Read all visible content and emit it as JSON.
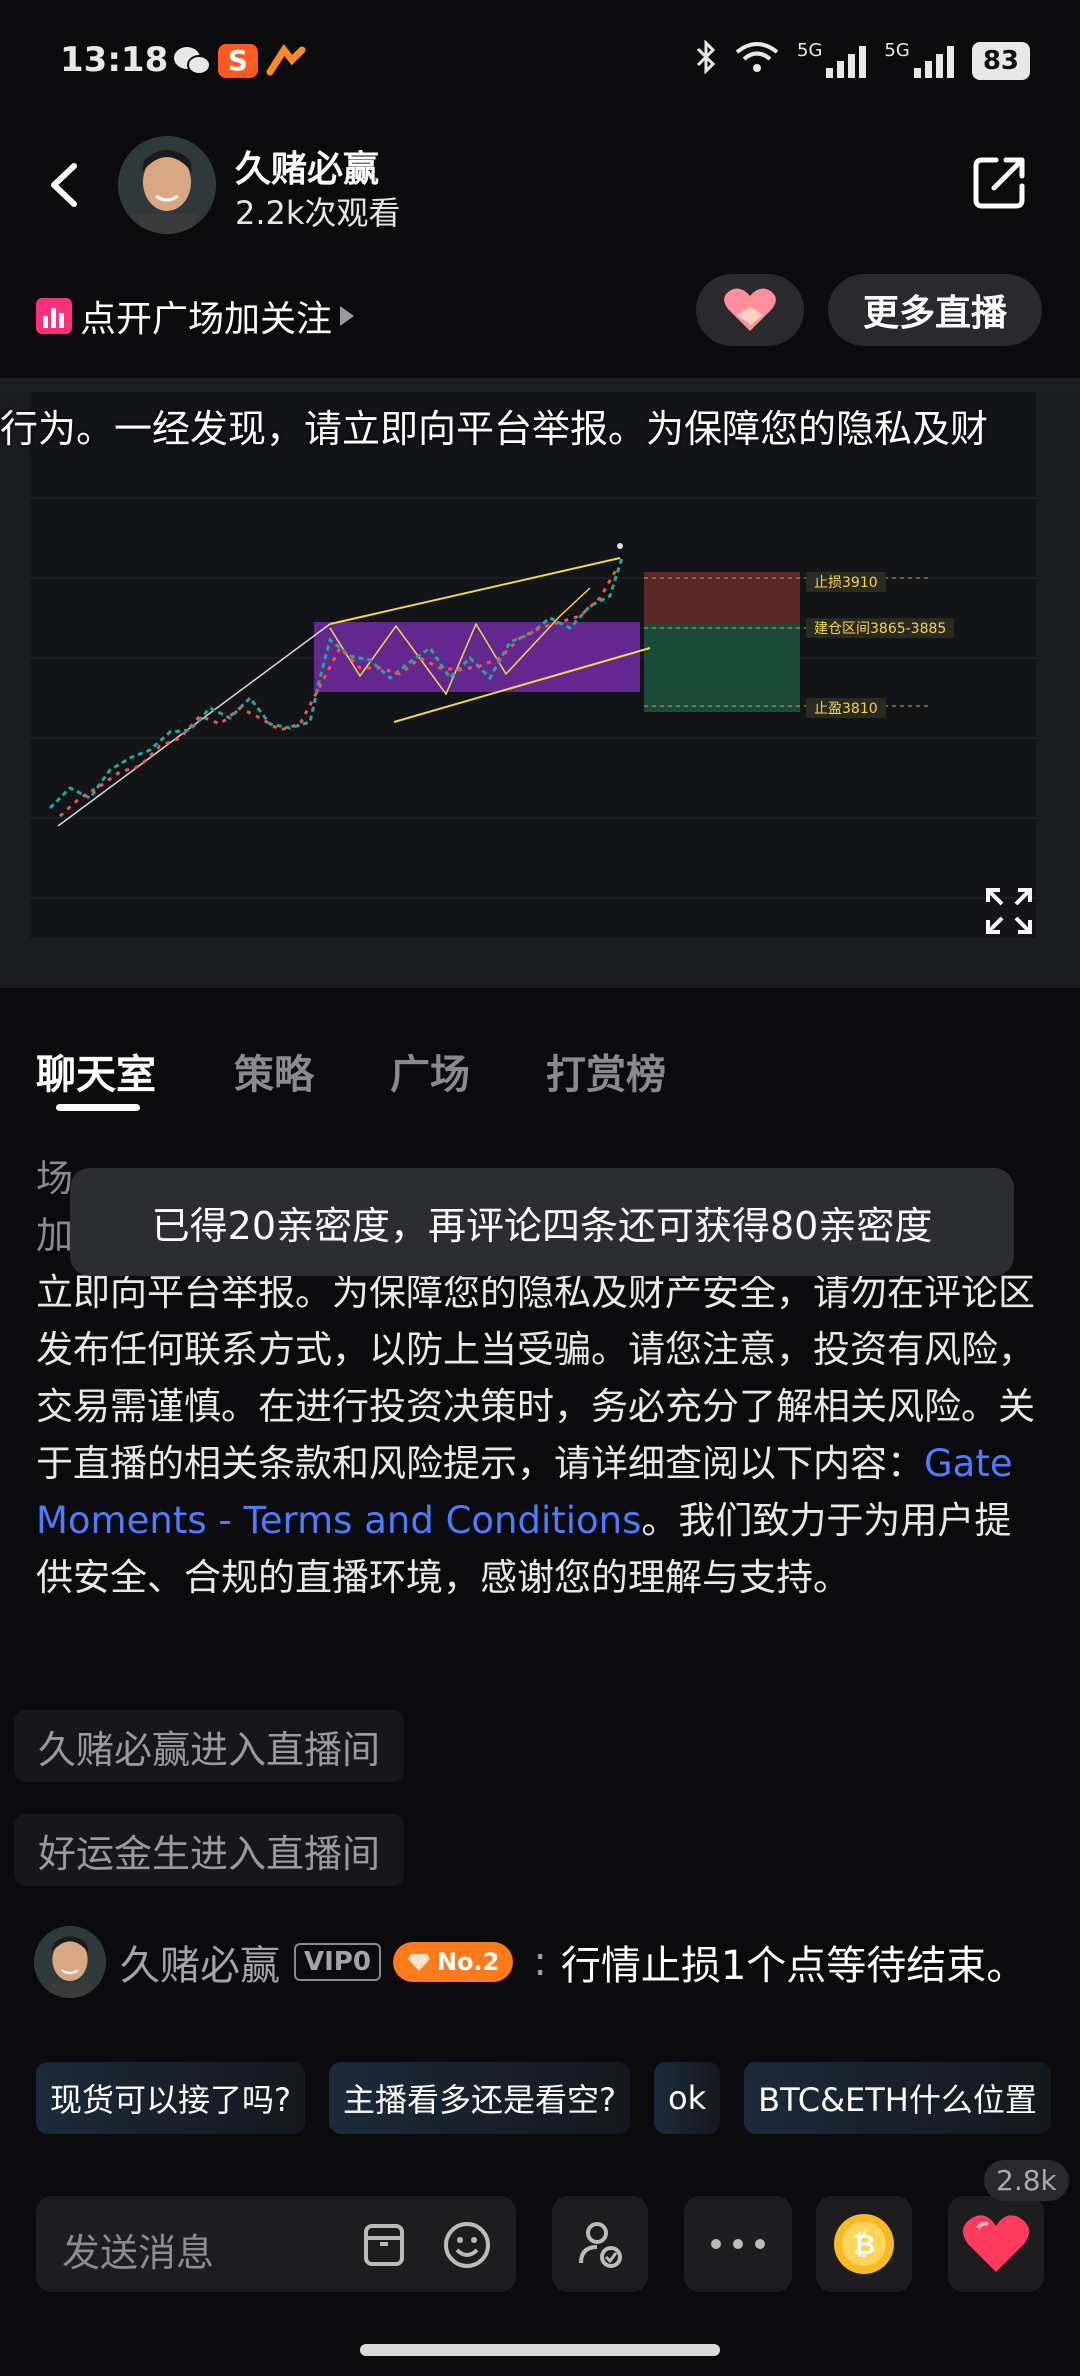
{
  "status_bar": {
    "time": "13:18",
    "battery": "83",
    "network_1": "5G",
    "network_2": "5G"
  },
  "header": {
    "streamer_name": "久赌必赢",
    "views": "2.2k次观看"
  },
  "follow": {
    "label": "点开广场加关注"
  },
  "more_live_label": "更多直播",
  "video": {
    "ticker": "行为。一经发现，请立即向平台举报。为保障您的隐私及财",
    "chart_labels": {
      "stop_loss": "止损3910",
      "entry_zone": "建仓区间3865-3885",
      "take_profit": "止盈3810"
    }
  },
  "tabs": [
    {
      "label": "聊天室",
      "active": true
    },
    {
      "label": "策略",
      "active": false
    },
    {
      "label": "广场",
      "active": false
    },
    {
      "label": "打赏榜",
      "active": false
    }
  ],
  "notice": {
    "partial_line_1": "场",
    "partial_line_2": "加",
    "body": "立即向平台举报。为保障您的隐私及财产安全，请勿在评论区发布任何联系方式，以防上当受骗。请您注意，投资有风险，交易需谨慎。在进行投资决策时，务必充分了解相关风险。关于直播的相关条款和风险提示，请详细查阅以下内容：",
    "link_text": "Gate Moments - Terms and Conditions",
    "tail": "。我们致力于为用户提供安全、合规的直播环境，感谢您的理解与支持。"
  },
  "toast": "已得20亲密度，再评论四条还可获得80亲密度",
  "enter_messages": [
    "久赌必赢进入直播间",
    "好运金生进入直播间"
  ],
  "chat_message": {
    "name": "久赌必赢",
    "vip": "VIP0",
    "rank": "No.2",
    "text": "行情止损1个点等待结束。"
  },
  "quick_replies": [
    "现货可以接了吗?",
    "主播看多还是看空?",
    "ok",
    "BTC&ETH什么位置"
  ],
  "input": {
    "placeholder": "发送消息"
  },
  "likes_count": "2.8k",
  "colors": {
    "accent_link": "#4d7cff",
    "heart": "#ff3a5c",
    "rank_badge": "#ff7a1a"
  }
}
